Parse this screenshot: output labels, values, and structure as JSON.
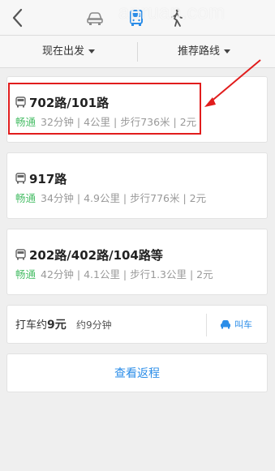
{
  "header": {
    "watermark": "apruan.com",
    "modes": [
      {
        "name": "car",
        "icon": "car-icon",
        "active": false
      },
      {
        "name": "bus",
        "icon": "bus-icon",
        "active": true
      },
      {
        "name": "walk",
        "icon": "walk-icon",
        "active": false
      }
    ]
  },
  "filters": {
    "depart": "现在出发",
    "sort": "推荐路线"
  },
  "routes": [
    {
      "line": "702路/101路",
      "status": "畅通",
      "detail": "32分钟 | 4公里 | 步行736米 | 2元"
    },
    {
      "line": "917路",
      "status": "畅通",
      "detail": "34分钟 | 4.9公里 | 步行776米 | 2元"
    },
    {
      "line": "202路/402路/104路等",
      "status": "畅通",
      "detail": "42分钟 | 4.1公里 | 步行1.3公里 | 2元"
    }
  ],
  "taxi": {
    "prefix": "打车约",
    "price": "9元",
    "time": "约9分钟",
    "call_label": "叫车"
  },
  "return_label": "查看返程",
  "colors": {
    "accent": "#2b8de8",
    "status_green": "#4cbf6a",
    "highlight": "#e11c1c"
  }
}
